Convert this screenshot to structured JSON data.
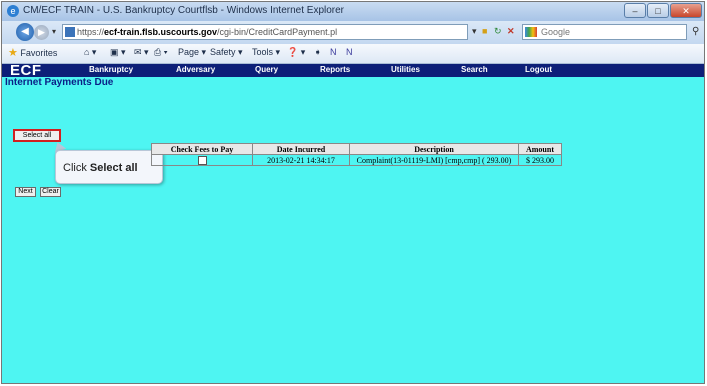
{
  "window": {
    "title": "CM/ECF TRAIN - U.S. Bankruptcy Courtflsb - Windows Internet Explorer",
    "minimize": "–",
    "maximize": "□",
    "close": "✕"
  },
  "address_bar": {
    "prefix": "https://",
    "host": "ecf-train.flsb.uscourts.gov",
    "path": "/cgi-bin/CreditCardPayment.pl",
    "search_placeholder": "Google"
  },
  "command_bar": {
    "favorites": "Favorites",
    "page": "Page ▾",
    "safety": "Safety ▾",
    "tools": "Tools ▾"
  },
  "ecf_menu": {
    "logo": "ECF",
    "items": [
      "Bankruptcy",
      "Adversary",
      "Query",
      "Reports",
      "Utilities",
      "Search",
      "Logout"
    ]
  },
  "page": {
    "title": "Internet Payments Due",
    "select_all": "Select all",
    "callout_prefix": "Click ",
    "callout_bold": "Select all",
    "next": "Next",
    "clear": "Clear"
  },
  "table": {
    "headers": [
      "Check Fees to Pay",
      "Date Incurred",
      "Description",
      "Amount"
    ],
    "rows": [
      {
        "date": "2013-02-21 14:34:17",
        "description": "Complaint(13-01119-LMI) [cmp,cmp] ( 293.00)",
        "amount": "$ 293.00"
      }
    ]
  },
  "colors": {
    "content_bg": "#4ef5f2",
    "menu_bg": "#0d1f78",
    "title_color": "#0a1f86",
    "highlight": "#d12020"
  }
}
